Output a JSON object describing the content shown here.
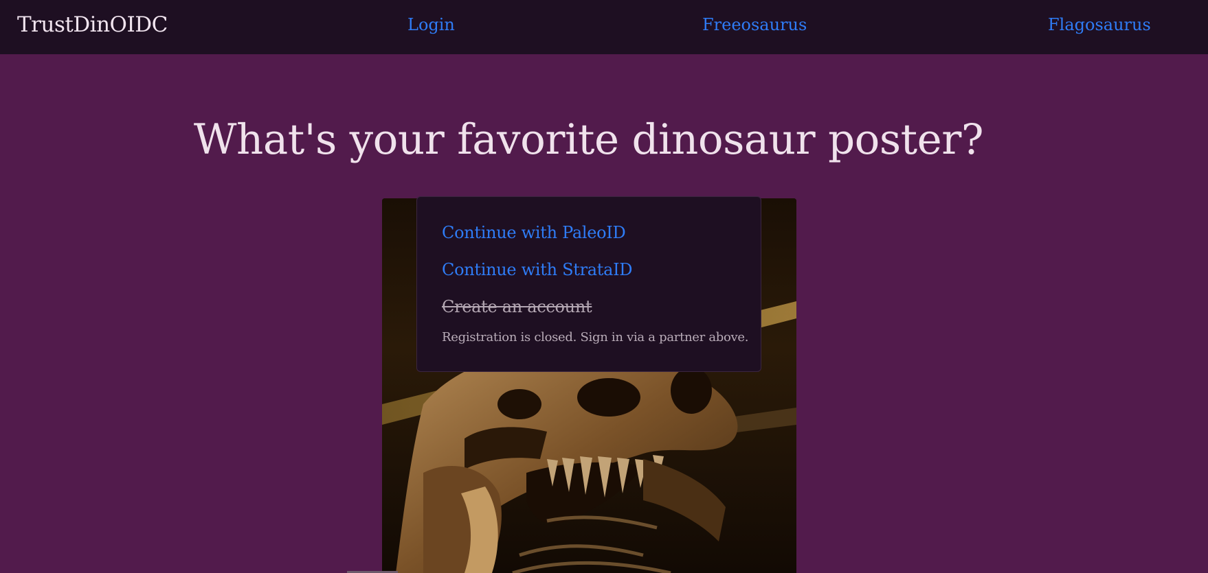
{
  "navbar": {
    "brand": "TrustDinOIDC",
    "links": [
      {
        "label": "Login"
      },
      {
        "label": "Freeosaurus"
      },
      {
        "label": "Flagosaurus"
      }
    ]
  },
  "main": {
    "headline": "What's your favorite dinosaur poster?"
  },
  "login_dropdown": {
    "options": [
      {
        "label": "Continue with PaleoID"
      },
      {
        "label": "Continue with StrataID"
      }
    ],
    "disabled_option": "Create an account",
    "note": "Registration is closed. Sign in via a partner above."
  },
  "colors": {
    "page_background": "#521b4c",
    "navbar_background": "#1e0f22",
    "link": "#2f7cf6",
    "text": "#f0e2ec"
  }
}
